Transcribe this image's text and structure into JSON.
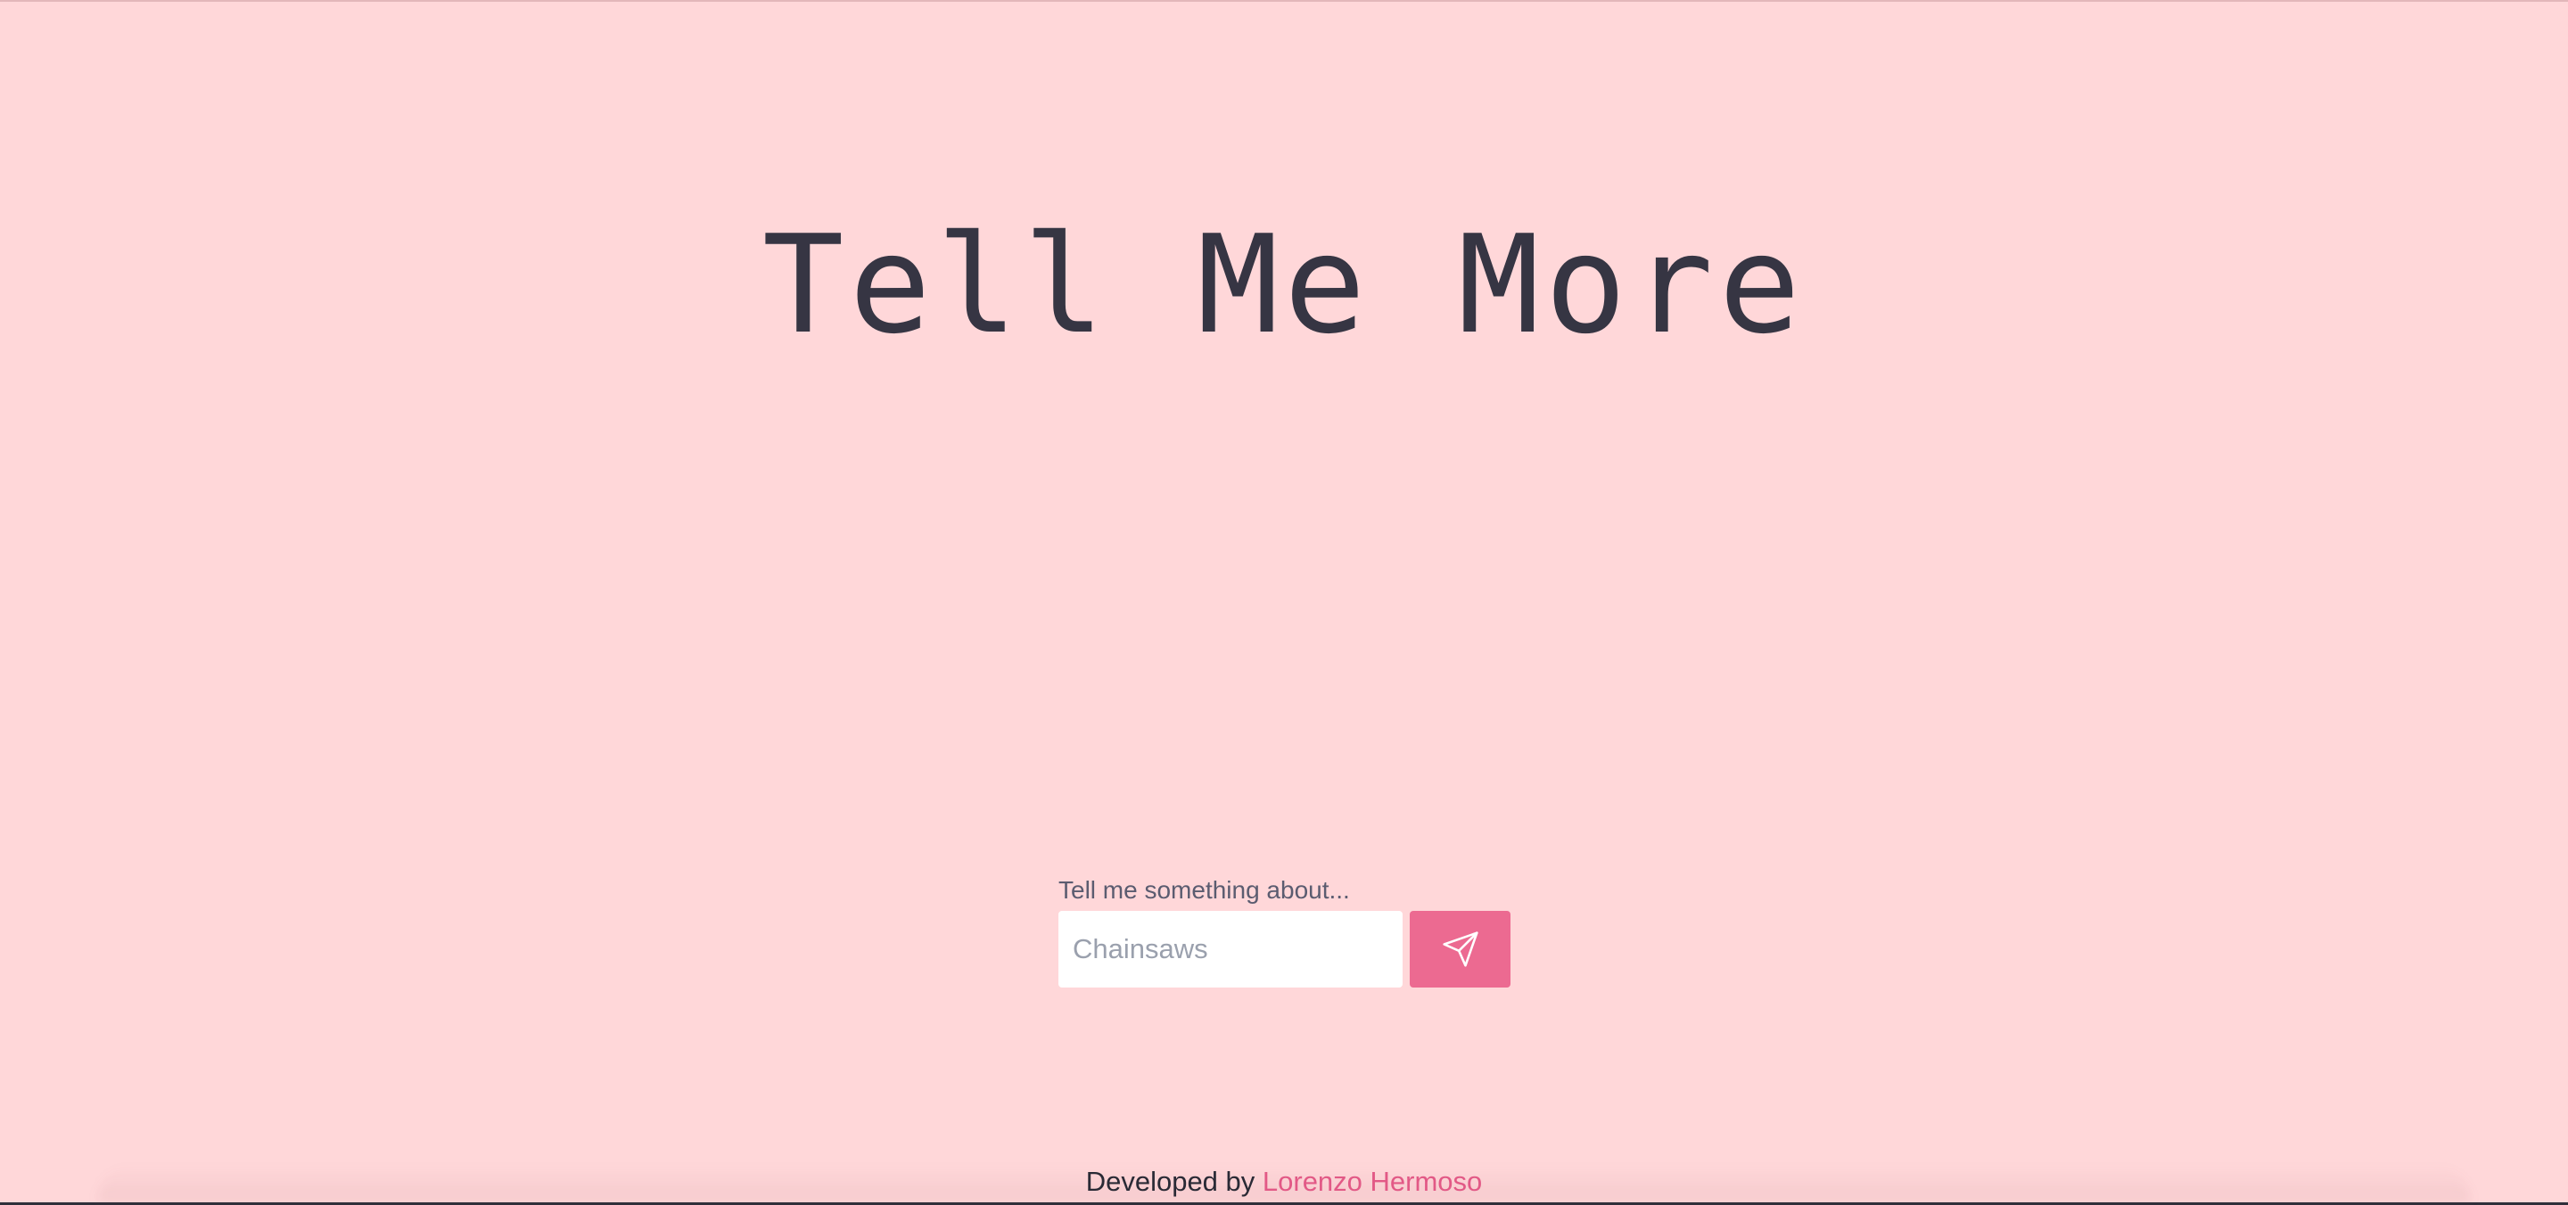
{
  "header": {
    "title": "Tell Me More"
  },
  "form": {
    "label": "Tell me something about...",
    "input_placeholder": "Chainsaws",
    "input_value": "",
    "submit_icon": "send-icon"
  },
  "footer": {
    "prefix": "Developed by ",
    "author_link": "Lorenzo Hermoso"
  },
  "colors": {
    "background": "#ffd7d9",
    "accent": "#ec6a91",
    "title": "#363543",
    "link": "#e25986"
  }
}
